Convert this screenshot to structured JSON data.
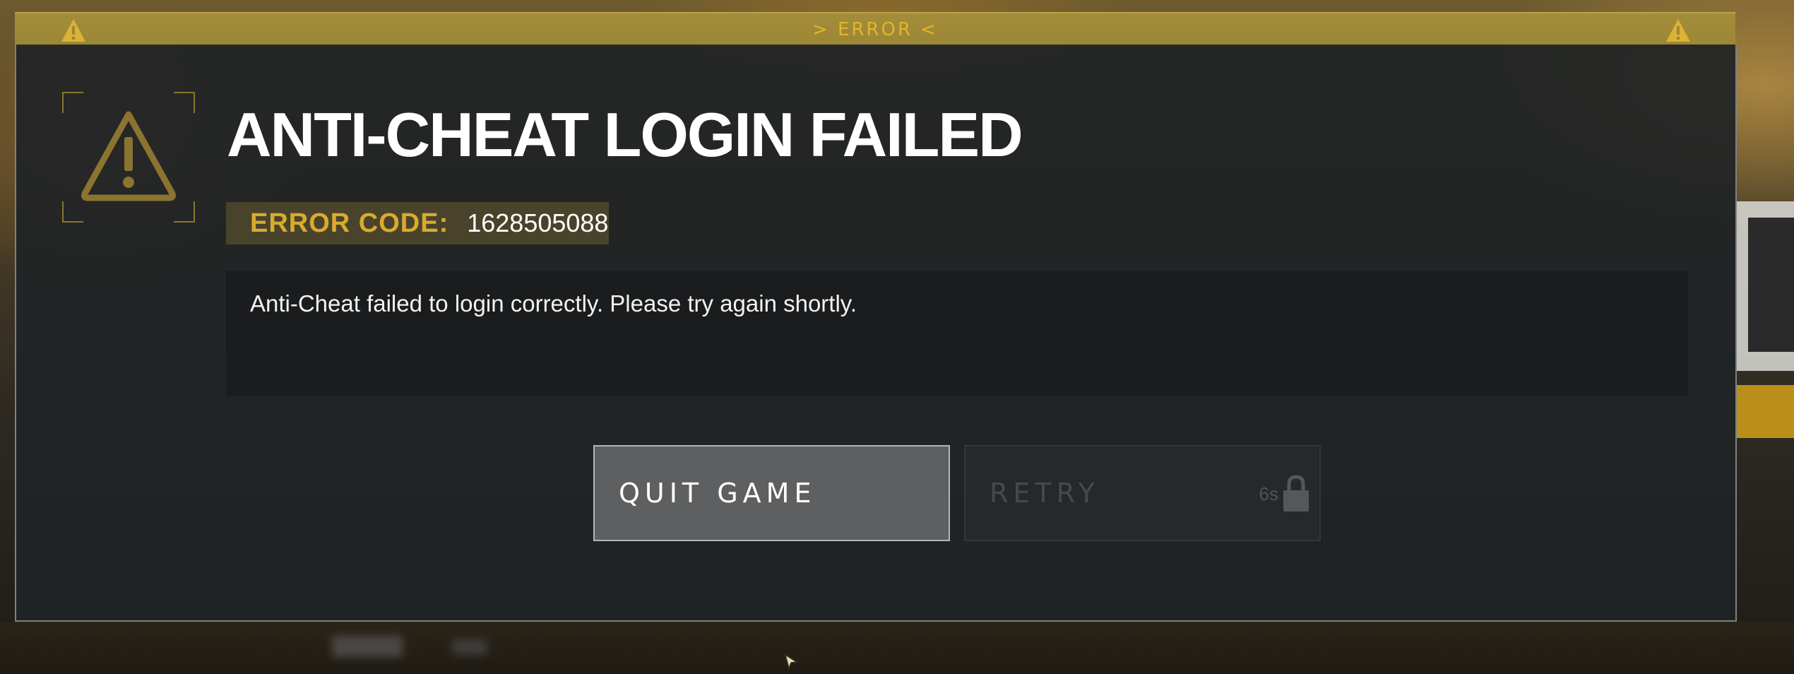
{
  "top_bar": {
    "title": "> ERROR <",
    "left_icon": "warning-icon",
    "right_icon": "warning-icon"
  },
  "dialog": {
    "icon": "warning-triangle-icon",
    "title": "ANTI-CHEAT LOGIN FAILED",
    "error_code_label": "ERROR CODE:",
    "error_code_value": "1628505088",
    "message": "Anti-Cheat failed to login correctly. Please try again shortly."
  },
  "buttons": {
    "quit_label": "QUIT GAME",
    "retry_label": "RETRY",
    "retry_timer": "6s",
    "retry_icon": "lock-icon"
  },
  "colors": {
    "accent": "#d8ab2e",
    "top_bar": "#a38d3a",
    "dialog_bg": "#202326"
  }
}
